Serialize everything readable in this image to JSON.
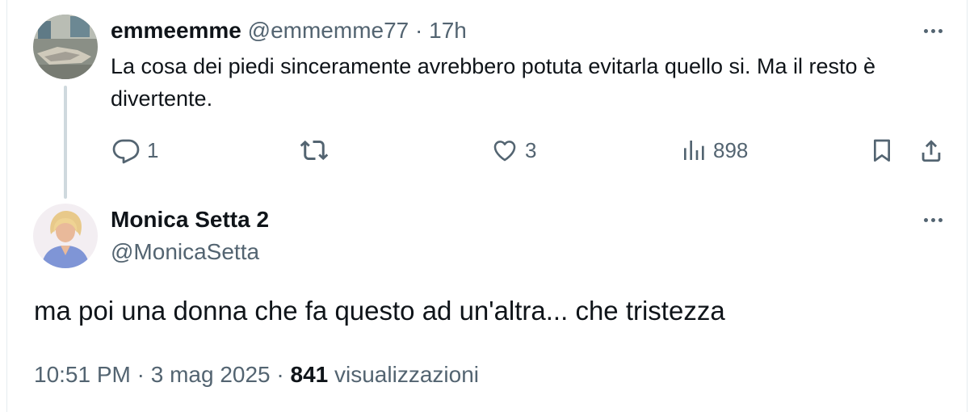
{
  "reply": {
    "display_name": "emmeemme",
    "handle": "@emmemme77",
    "separator": "·",
    "time": "17h",
    "text": "La cosa dei piedi sinceramente avrebbero potuta evitarla quello si. Ma il resto è divertente.",
    "actions": {
      "reply_count": "1",
      "repost_count": "",
      "like_count": "3",
      "views_count": "898"
    }
  },
  "main_post": {
    "display_name": "Monica Setta 2",
    "handle": "@MonicaSetta",
    "text": "ma poi una donna che fa questo ad un'altra... che tristezza",
    "timestamp": "10:51 PM · 3 mag 2025",
    "separator": "·",
    "views_count": "841",
    "views_label": "visualizzazioni"
  },
  "icons": [
    "more-icon",
    "reply-icon",
    "repost-icon",
    "like-icon",
    "views-icon",
    "bookmark-icon",
    "share-icon"
  ],
  "colors": {
    "text": "#0f1419",
    "secondary": "#536471",
    "thread_line": "#cfd9de",
    "border": "#e6ecf0"
  }
}
